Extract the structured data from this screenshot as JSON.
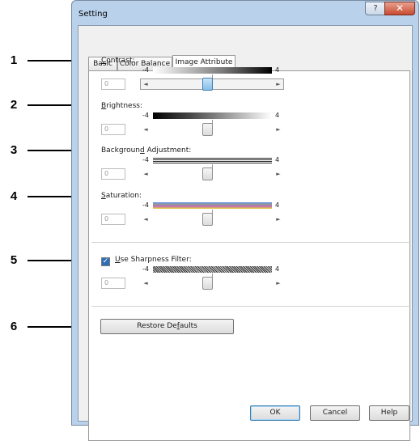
{
  "window": {
    "title": "Setting",
    "help_glyph": "?",
    "close_glyph": "✕"
  },
  "tabs": [
    {
      "label": "Basic"
    },
    {
      "label": "Color Balance"
    },
    {
      "label": "Image Attribute",
      "active": true
    }
  ],
  "callouts": [
    "1",
    "2",
    "3",
    "4",
    "5",
    "6"
  ],
  "sliders": [
    {
      "label_parts": [
        "",
        "C",
        "ontrast:"
      ],
      "min_label": "-4",
      "max_label": "4",
      "value": "0",
      "level": 0.5,
      "bar": "contrast",
      "focused": true
    },
    {
      "label_parts": [
        "",
        "B",
        "rightness:"
      ],
      "min_label": "-4",
      "max_label": "4",
      "value": "0",
      "level": 0.5,
      "bar": "brightness",
      "focused": false
    },
    {
      "label_parts": [
        "Backgroun",
        "d",
        " Adjustment:"
      ],
      "min_label": "-4",
      "max_label": "4",
      "value": "0",
      "level": 0.5,
      "bar": "background",
      "focused": false
    },
    {
      "label_parts": [
        "",
        "S",
        "aturation:"
      ],
      "min_label": "-4",
      "max_label": "4",
      "value": "0",
      "level": 0.5,
      "bar": "saturation",
      "focused": false
    },
    {
      "label_parts": [
        "",
        "U",
        "se Sharpness Filter:"
      ],
      "min_label": "-4",
      "max_label": "4",
      "value": "0",
      "level": 0.5,
      "bar": "sharpness",
      "focused": false
    }
  ],
  "sharpness_checkbox": {
    "checked": true,
    "glyph": "✓"
  },
  "arrows": {
    "left": "◄",
    "right": "►"
  },
  "restore_button": {
    "label_parts": [
      "Restore De",
      "f",
      "aults"
    ]
  },
  "footer_buttons": {
    "ok": "OK",
    "cancel": "Cancel",
    "help": "Help"
  },
  "colors": {
    "frame": "#b9d1ea",
    "panel": "#ffffff",
    "focus": "#3c7fb1"
  }
}
